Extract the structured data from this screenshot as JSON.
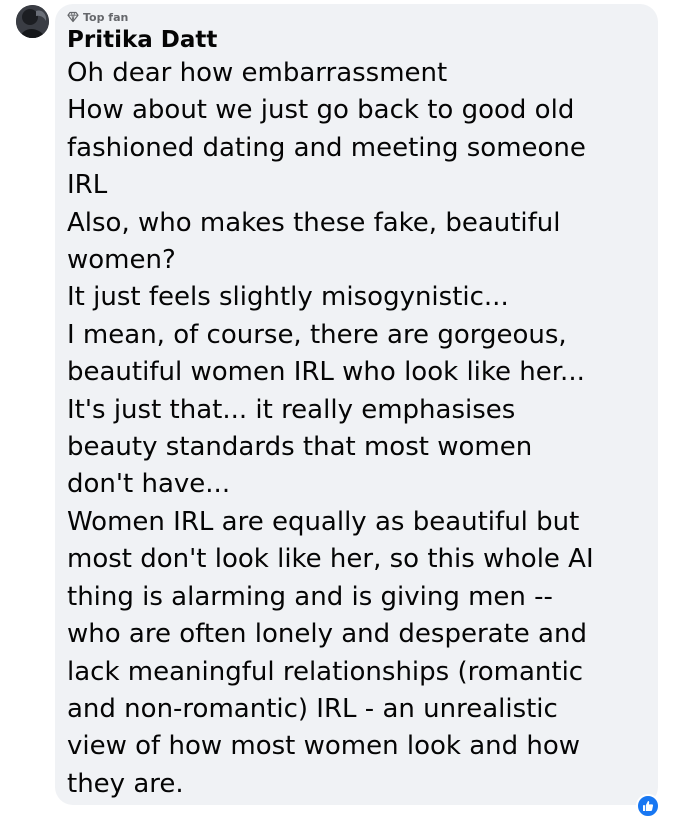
{
  "comment": {
    "badge_label": "Top fan",
    "badge_icon": "diamond-icon",
    "author": "Pritika Datt",
    "lines": [
      "Oh dear how embarrassment",
      "How about we just go back to good old",
      "fashioned dating and meeting someone",
      "IRL",
      "Also, who makes these fake, beautiful",
      "women?",
      "It just feels slightly misogynistic...",
      "I mean, of course, there are gorgeous,",
      "beautiful women IRL who look like her...",
      "It's just that... it really emphasises",
      "beauty standards that most women",
      "don't have...",
      "Women IRL are equally as beautiful but",
      "most don't look like her, so this whole AI",
      "thing is alarming and is giving men --",
      "who are often lonely and desperate and",
      "lack meaningful relationships (romantic",
      "and non-romantic) IRL - an unrealistic",
      "view of how most women look and how",
      "they are."
    ],
    "reaction_icon": "thumbs-up-icon"
  },
  "colors": {
    "bubble": "#f0f2f5",
    "text": "#050505",
    "secondary_text": "#65676b",
    "like_blue": "#1877f2"
  }
}
